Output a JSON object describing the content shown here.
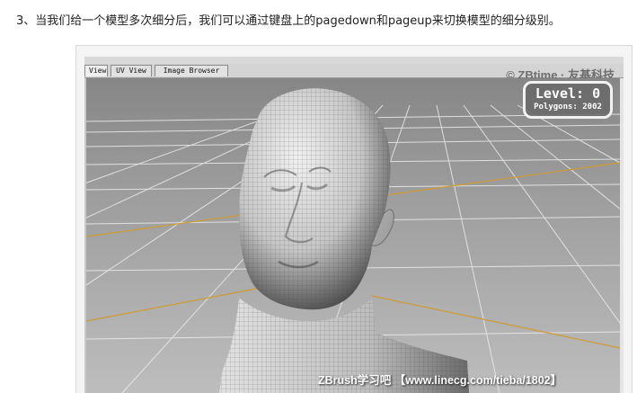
{
  "caption": "3、当我们给一个模型多次细分后，我们可以通过键盘上的pagedown和pageup来切换模型的细分级别。",
  "app": {
    "tabs": [
      {
        "label": "View",
        "active": true
      },
      {
        "label": "UV View",
        "active": false
      },
      {
        "label": "Image Browser",
        "active": false
      }
    ],
    "watermark_top": "© ZBtime · 友基科技",
    "level_label": "Level: 0",
    "polygons_label": "Polygons: 2002",
    "watermark_bottom": "ZBrush学习吧 【www.linecg.com/tieba/1802】"
  },
  "colors": {
    "viewport_top": "#8a8a8a",
    "viewport_bottom": "#b9b9b9",
    "grid_line": "#e8e8e8",
    "axis_line": "#d4a035",
    "model_shade": "#d8d8d8"
  },
  "icons": [
    "copyright-icon"
  ]
}
